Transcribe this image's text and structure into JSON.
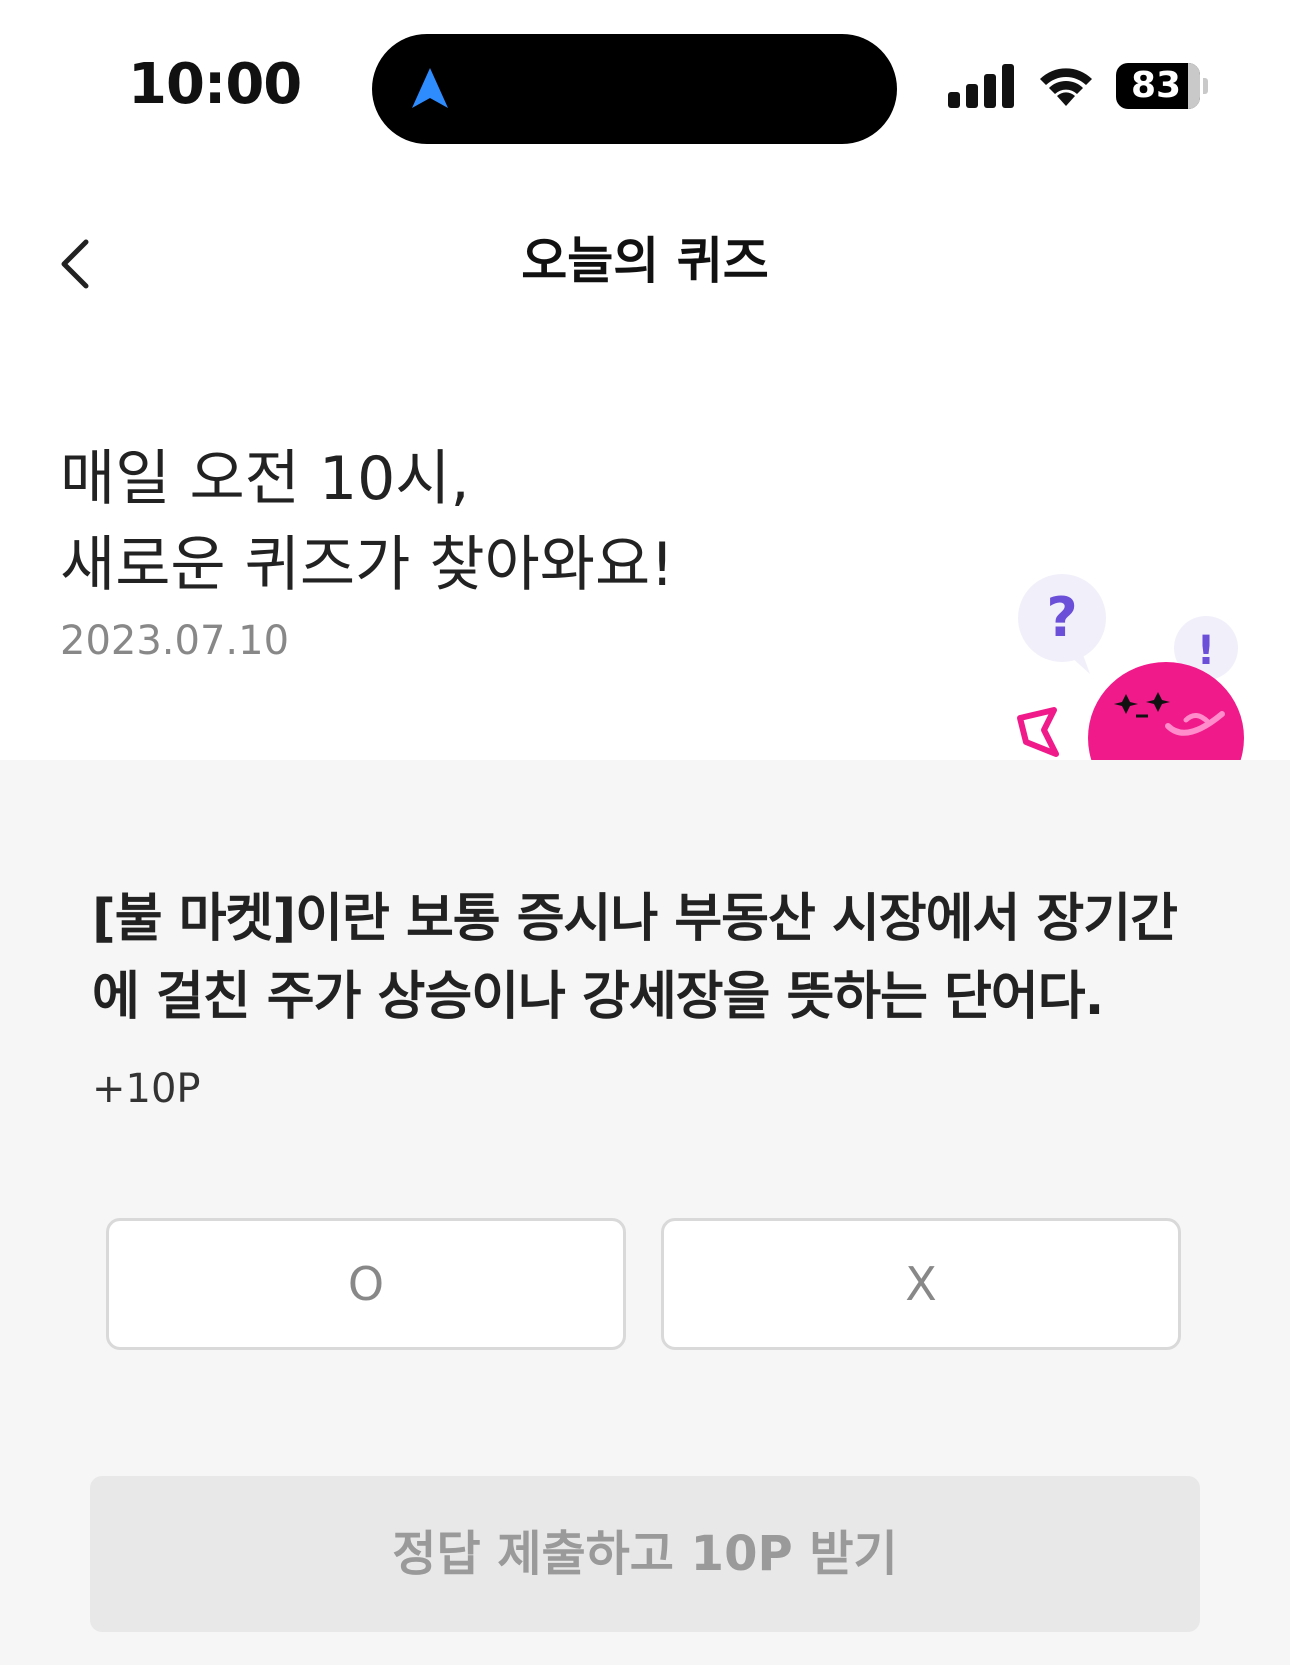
{
  "status_bar": {
    "time": "10:00",
    "battery_level": "83",
    "icons": [
      "navigation-arrow-icon",
      "signal-icon",
      "wifi-icon",
      "battery-icon"
    ]
  },
  "header": {
    "title": "오늘의 퀴즈",
    "back_icon": "chevron-left-icon"
  },
  "intro": {
    "line1": "매일 오전 10시,",
    "line2": "새로운 퀴즈가 찾아와요!",
    "date": "2023.07.10"
  },
  "quiz": {
    "question": "[불 마켓]이란 보통 증시나 부동산 시장에서 장기간에 걸친 주가 상승이나 강세장을 뜻하는 단어다.",
    "reward": "+10P",
    "options": [
      "O",
      "X"
    ],
    "submit_label": "정답 제출하고 10P 받기"
  },
  "mascot": {
    "icon": "quiz-mascot-illustration",
    "bubble_question": "?",
    "bubble_exclaim": "!"
  },
  "colors": {
    "accent_pink": "#f01a8a",
    "bubble_purple": "#6b4fd8",
    "panel_bg": "#f6f6f6",
    "submit_disabled_bg": "#e8e8e8",
    "nav_blue": "#2f8cff"
  }
}
